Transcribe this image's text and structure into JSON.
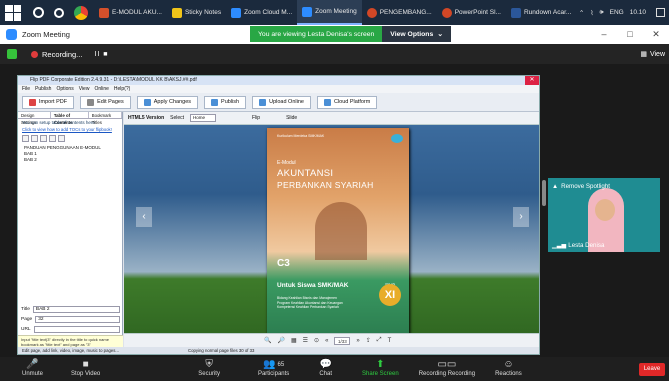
{
  "taskbar": {
    "apps": [
      {
        "label": "E-MODUL AKU...",
        "color": "#d4502b",
        "active": false
      },
      {
        "label": "Sticky Notes",
        "color": "#f0c419",
        "active": false
      },
      {
        "label": "Zoom Cloud M...",
        "color": "#2d8cff",
        "active": false
      },
      {
        "label": "Zoom Meeting",
        "color": "#2d8cff",
        "active": true
      },
      {
        "label": "PENGEMBANG...",
        "color": "#d24726",
        "active": false
      },
      {
        "label": "PowerPoint Sl...",
        "color": "#d24726",
        "active": false
      },
      {
        "label": "Rundown Acar...",
        "color": "#2b579a",
        "active": false
      }
    ],
    "tray": {
      "language": "ENG",
      "time": "10.10"
    }
  },
  "window": {
    "title": "Zoom Meeting"
  },
  "share": {
    "viewing_text": "You are viewing Lesta Denisa's screen",
    "options_label": "View Options"
  },
  "recording": {
    "label": "Recording...",
    "controls": "II  ■",
    "view_label": "View"
  },
  "flipbook": {
    "title": "Flip PDF Corporate Edition 2.4.9.31 - D:\\LESTA\\MODUL KK B\\AKSJ.##.pdf",
    "menu": [
      "File",
      "Publish",
      "Options",
      "View",
      "Online",
      "Help(?)"
    ],
    "ribbon": [
      "Import PDF",
      "Edit Pages",
      "Apply Changes",
      "Publish",
      "Upload Online",
      "Cloud Platform"
    ],
    "left_tabs": [
      "Design Settings",
      "Table of Contents",
      "Bookmark Titles"
    ],
    "left_note": "You can setup table of contents here",
    "left_link": "Click to view how to add TOCs to your flipbook!",
    "tree": [
      "PANDUAN PENGGUNAAN E-MODUL",
      "BAB 1",
      "BAB 2"
    ],
    "form": {
      "title_label": "Title",
      "title_value": "BAB 2",
      "page_label": "Page",
      "page_value": "32",
      "url_label": "URL"
    },
    "tip": "Input \"title text|3\" directly in the title to quick name bookmark as \"title text\" and page as \"3\"",
    "view_toolbar": {
      "version": "HTML5 Version",
      "select_label": "Select",
      "select_value": "Home",
      "flip": "Flip",
      "slide": "Slide"
    },
    "status_left": "Edit page, add link, video, image, music to pages...",
    "status_mid": "Copying normal page files 30 of 33",
    "page_box": "1/33"
  },
  "book": {
    "small_text": "Kurikulum Merdeka\nSMK/MAK",
    "emodul": "E-Modul",
    "title1": "AKUNTANSI",
    "title2": "PERBANKAN SYARIAH",
    "code": "C3",
    "untuk": "Untuk Siswa SMK/MAK",
    "kelas": "KELAS",
    "grade": "XI",
    "subtitle": "Bidang Keahlian Bisnis dan Manajemen\nProgram Keahlian Akuntansi dan Keuangan\nKompetensi Keahlian Perbankan Syariah"
  },
  "video": {
    "spotlight": "Remove Spotlight",
    "name": "Lesta Denisa"
  },
  "controls": [
    {
      "label": "Unmute",
      "icon": "mic-muted-icon"
    },
    {
      "label": "Stop Video",
      "icon": "video-icon"
    },
    {
      "label": "Security",
      "icon": "shield-icon"
    },
    {
      "label": "Participants",
      "icon": "participants-icon",
      "count": "65"
    },
    {
      "label": "Chat",
      "icon": "chat-icon"
    },
    {
      "label": "Share Screen",
      "icon": "share-screen-icon"
    },
    {
      "label": "Recording Recording",
      "icon": "record-icon"
    },
    {
      "label": "Reactions",
      "icon": "reactions-icon"
    }
  ],
  "leave_label": "Leave"
}
